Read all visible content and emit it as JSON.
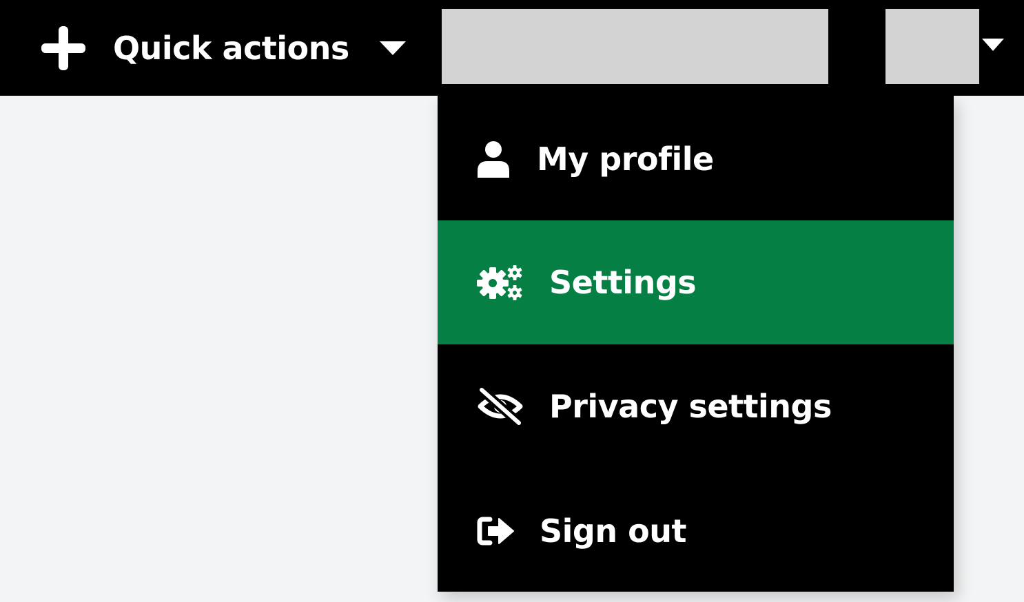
{
  "topbar": {
    "quick_actions": {
      "label": "Quick actions",
      "icon": "plus-icon",
      "chevron_icon": "chevron-down-icon"
    },
    "account_chevron_icon": "chevron-down-icon"
  },
  "account_menu": {
    "items": [
      {
        "label": "My profile",
        "icon": "user-icon",
        "active": false
      },
      {
        "label": "Settings",
        "icon": "gears-icon",
        "active": true
      },
      {
        "label": "Privacy settings",
        "icon": "eye-slash-icon",
        "active": false
      },
      {
        "label": "Sign out",
        "icon": "sign-out-icon",
        "active": false
      }
    ]
  },
  "colors": {
    "topbar_background": "#000000",
    "menu_background": "#000000",
    "active_item": "#067f45",
    "text": "#ffffff",
    "placeholder": "#d3d3d3",
    "page_background": "#f2f4f5"
  }
}
